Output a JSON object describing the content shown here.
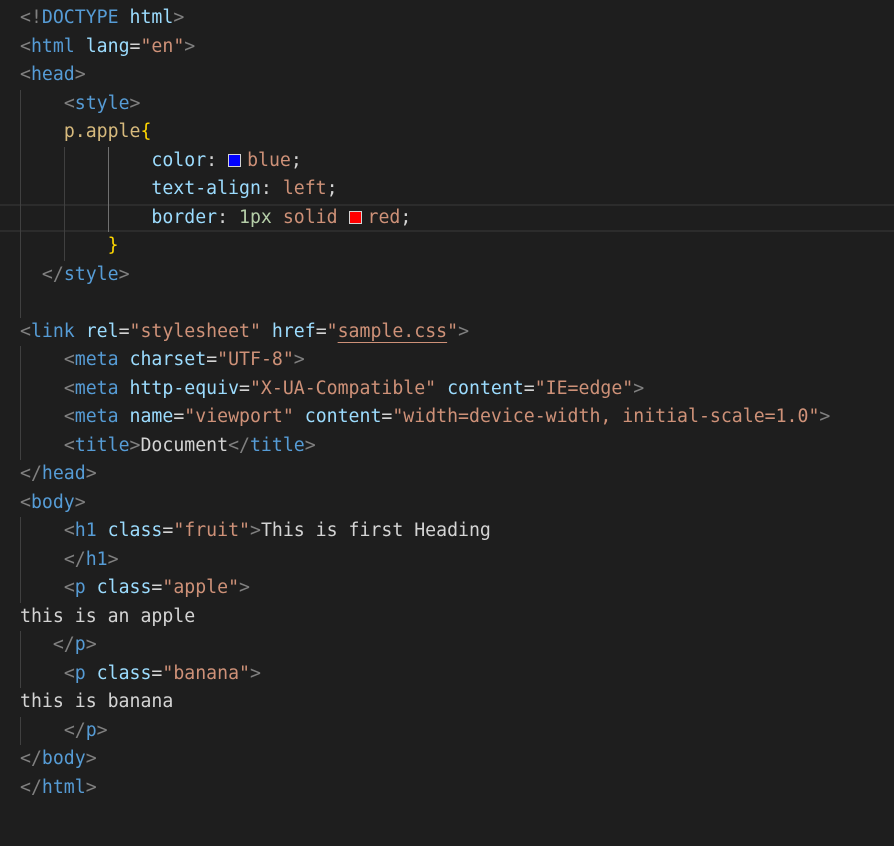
{
  "editor": {
    "lines": [
      {
        "indent": "",
        "tokens": [
          {
            "t": "<!",
            "c": "t-punc"
          },
          {
            "t": "DOCTYPE",
            "c": "t-tag"
          },
          {
            "t": " ",
            "c": "t-text"
          },
          {
            "t": "html",
            "c": "t-attr"
          },
          {
            "t": ">",
            "c": "t-punc"
          }
        ]
      },
      {
        "indent": "",
        "tokens": [
          {
            "t": "<",
            "c": "t-punc"
          },
          {
            "t": "html",
            "c": "t-tag"
          },
          {
            "t": " ",
            "c": "t-text"
          },
          {
            "t": "lang",
            "c": "t-attr"
          },
          {
            "t": "=",
            "c": "t-text"
          },
          {
            "t": "\"en\"",
            "c": "t-str"
          },
          {
            "t": ">",
            "c": "t-punc"
          }
        ]
      },
      {
        "indent": "",
        "tokens": [
          {
            "t": "<",
            "c": "t-punc"
          },
          {
            "t": "head",
            "c": "t-tag"
          },
          {
            "t": ">",
            "c": "t-punc"
          }
        ]
      },
      {
        "indent": "    ",
        "tokens": [
          {
            "t": "<",
            "c": "t-punc"
          },
          {
            "t": "style",
            "c": "t-tag"
          },
          {
            "t": ">",
            "c": "t-punc"
          }
        ]
      },
      {
        "indent": "    ",
        "tokens": [
          {
            "t": "p.apple",
            "c": "t-sel"
          },
          {
            "t": "{",
            "c": "t-brace"
          }
        ]
      },
      {
        "indent": "            ",
        "tokens": [
          {
            "t": "color",
            "c": "t-prop"
          },
          {
            "t": ": ",
            "c": "t-text"
          },
          {
            "swatch": "#0000ff"
          },
          {
            "t": "blue",
            "c": "t-val"
          },
          {
            "t": ";",
            "c": "t-text"
          }
        ]
      },
      {
        "indent": "            ",
        "tokens": [
          {
            "t": "text-align",
            "c": "t-prop"
          },
          {
            "t": ": ",
            "c": "t-text"
          },
          {
            "t": "left",
            "c": "t-val"
          },
          {
            "t": ";",
            "c": "t-text"
          }
        ]
      },
      {
        "indent": "            ",
        "active": true,
        "tokens": [
          {
            "t": "border",
            "c": "t-prop"
          },
          {
            "t": ": ",
            "c": "t-text"
          },
          {
            "t": "1px",
            "c": "t-num"
          },
          {
            "t": " ",
            "c": "t-text"
          },
          {
            "t": "solid",
            "c": "t-val"
          },
          {
            "t": " ",
            "c": "t-text"
          },
          {
            "swatch": "#ff0000"
          },
          {
            "t": "red",
            "c": "t-val"
          },
          {
            "t": ";",
            "c": "t-text"
          }
        ]
      },
      {
        "indent": "        ",
        "tokens": [
          {
            "t": "}",
            "c": "t-brace"
          }
        ]
      },
      {
        "indent": "  ",
        "tokens": [
          {
            "t": "</",
            "c": "t-punc"
          },
          {
            "t": "style",
            "c": "t-tag"
          },
          {
            "t": ">",
            "c": "t-punc"
          }
        ]
      },
      {
        "indent": "",
        "tokens": []
      },
      {
        "indent": "",
        "tokens": [
          {
            "t": "<",
            "c": "t-punc"
          },
          {
            "t": "link",
            "c": "t-tag"
          },
          {
            "t": " ",
            "c": "t-text"
          },
          {
            "t": "rel",
            "c": "t-attr"
          },
          {
            "t": "=",
            "c": "t-text"
          },
          {
            "t": "\"stylesheet\"",
            "c": "t-str"
          },
          {
            "t": " ",
            "c": "t-text"
          },
          {
            "t": "href",
            "c": "t-attr"
          },
          {
            "t": "=",
            "c": "t-text"
          },
          {
            "t": "\"",
            "c": "t-str"
          },
          {
            "t": "sample.css",
            "c": "t-str t-link"
          },
          {
            "t": "\"",
            "c": "t-str"
          },
          {
            "t": ">",
            "c": "t-punc"
          }
        ]
      },
      {
        "indent": "    ",
        "tokens": [
          {
            "t": "<",
            "c": "t-punc"
          },
          {
            "t": "meta",
            "c": "t-tag"
          },
          {
            "t": " ",
            "c": "t-text"
          },
          {
            "t": "charset",
            "c": "t-attr"
          },
          {
            "t": "=",
            "c": "t-text"
          },
          {
            "t": "\"UTF-8\"",
            "c": "t-str"
          },
          {
            "t": ">",
            "c": "t-punc"
          }
        ]
      },
      {
        "indent": "    ",
        "tokens": [
          {
            "t": "<",
            "c": "t-punc"
          },
          {
            "t": "meta",
            "c": "t-tag"
          },
          {
            "t": " ",
            "c": "t-text"
          },
          {
            "t": "http-equiv",
            "c": "t-attr"
          },
          {
            "t": "=",
            "c": "t-text"
          },
          {
            "t": "\"X-UA-Compatible\"",
            "c": "t-str"
          },
          {
            "t": " ",
            "c": "t-text"
          },
          {
            "t": "content",
            "c": "t-attr"
          },
          {
            "t": "=",
            "c": "t-text"
          },
          {
            "t": "\"IE=edge\"",
            "c": "t-str"
          },
          {
            "t": ">",
            "c": "t-punc"
          }
        ]
      },
      {
        "indent": "    ",
        "tokens": [
          {
            "t": "<",
            "c": "t-punc"
          },
          {
            "t": "meta",
            "c": "t-tag"
          },
          {
            "t": " ",
            "c": "t-text"
          },
          {
            "t": "name",
            "c": "t-attr"
          },
          {
            "t": "=",
            "c": "t-text"
          },
          {
            "t": "\"viewport\"",
            "c": "t-str"
          },
          {
            "t": " ",
            "c": "t-text"
          },
          {
            "t": "content",
            "c": "t-attr"
          },
          {
            "t": "=",
            "c": "t-text"
          },
          {
            "t": "\"width=device-width, initial-scale=1.0\"",
            "c": "t-str"
          },
          {
            "t": ">",
            "c": "t-punc"
          }
        ]
      },
      {
        "indent": "    ",
        "tokens": [
          {
            "t": "<",
            "c": "t-punc"
          },
          {
            "t": "title",
            "c": "t-tag"
          },
          {
            "t": ">",
            "c": "t-punc"
          },
          {
            "t": "Document",
            "c": "t-text"
          },
          {
            "t": "</",
            "c": "t-punc"
          },
          {
            "t": "title",
            "c": "t-tag"
          },
          {
            "t": ">",
            "c": "t-punc"
          }
        ]
      },
      {
        "indent": "",
        "tokens": [
          {
            "t": "</",
            "c": "t-punc"
          },
          {
            "t": "head",
            "c": "t-tag"
          },
          {
            "t": ">",
            "c": "t-punc"
          }
        ]
      },
      {
        "indent": "",
        "tokens": [
          {
            "t": "<",
            "c": "t-punc"
          },
          {
            "t": "body",
            "c": "t-tag"
          },
          {
            "t": ">",
            "c": "t-punc"
          }
        ]
      },
      {
        "indent": "    ",
        "tokens": [
          {
            "t": "<",
            "c": "t-punc"
          },
          {
            "t": "h1",
            "c": "t-tag"
          },
          {
            "t": " ",
            "c": "t-text"
          },
          {
            "t": "class",
            "c": "t-attr"
          },
          {
            "t": "=",
            "c": "t-text"
          },
          {
            "t": "\"fruit\"",
            "c": "t-str"
          },
          {
            "t": ">",
            "c": "t-punc"
          },
          {
            "t": "This is first Heading",
            "c": "t-text"
          }
        ]
      },
      {
        "indent": "    ",
        "tokens": [
          {
            "t": "</",
            "c": "t-punc"
          },
          {
            "t": "h1",
            "c": "t-tag"
          },
          {
            "t": ">",
            "c": "t-punc"
          }
        ]
      },
      {
        "indent": "    ",
        "tokens": [
          {
            "t": "<",
            "c": "t-punc"
          },
          {
            "t": "p",
            "c": "t-tag"
          },
          {
            "t": " ",
            "c": "t-text"
          },
          {
            "t": "class",
            "c": "t-attr"
          },
          {
            "t": "=",
            "c": "t-text"
          },
          {
            "t": "\"apple\"",
            "c": "t-str"
          },
          {
            "t": ">",
            "c": "t-punc"
          }
        ]
      },
      {
        "indent": "",
        "tokens": [
          {
            "t": "this is an apple",
            "c": "t-text"
          }
        ]
      },
      {
        "indent": "   ",
        "tokens": [
          {
            "t": "</",
            "c": "t-punc"
          },
          {
            "t": "p",
            "c": "t-tag"
          },
          {
            "t": ">",
            "c": "t-punc"
          }
        ]
      },
      {
        "indent": "    ",
        "tokens": [
          {
            "t": "<",
            "c": "t-punc"
          },
          {
            "t": "p",
            "c": "t-tag"
          },
          {
            "t": " ",
            "c": "t-text"
          },
          {
            "t": "class",
            "c": "t-attr"
          },
          {
            "t": "=",
            "c": "t-text"
          },
          {
            "t": "\"banana\"",
            "c": "t-str"
          },
          {
            "t": ">",
            "c": "t-punc"
          }
        ]
      },
      {
        "indent": "",
        "tokens": [
          {
            "t": "this is banana",
            "c": "t-text"
          }
        ]
      },
      {
        "indent": "    ",
        "tokens": [
          {
            "t": "</",
            "c": "t-punc"
          },
          {
            "t": "p",
            "c": "t-tag"
          },
          {
            "t": ">",
            "c": "t-punc"
          }
        ]
      },
      {
        "indent": "",
        "tokens": [
          {
            "t": "</",
            "c": "t-punc"
          },
          {
            "t": "body",
            "c": "t-tag"
          },
          {
            "t": ">",
            "c": "t-punc"
          }
        ]
      },
      {
        "indent": "",
        "tokens": [
          {
            "t": "</",
            "c": "t-punc"
          },
          {
            "t": "html",
            "c": "t-tag"
          },
          {
            "t": ">",
            "c": "t-punc"
          }
        ]
      }
    ]
  }
}
